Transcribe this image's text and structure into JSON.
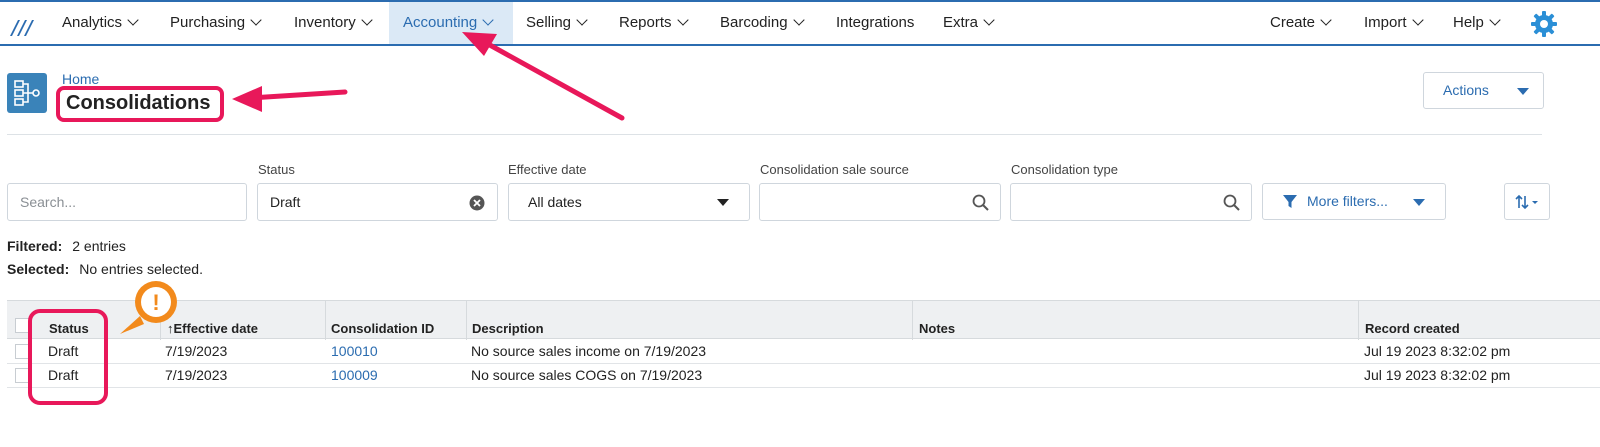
{
  "nav": {
    "items": [
      {
        "label": "Analytics"
      },
      {
        "label": "Purchasing"
      },
      {
        "label": "Inventory"
      },
      {
        "label": "Accounting"
      },
      {
        "label": "Selling"
      },
      {
        "label": "Reports"
      },
      {
        "label": "Barcoding"
      },
      {
        "label": "Integrations"
      },
      {
        "label": "Extra"
      }
    ],
    "right_items": [
      {
        "label": "Create"
      },
      {
        "label": "Import"
      },
      {
        "label": "Help"
      }
    ],
    "active": "Accounting",
    "accent_color": "#2b6cb0"
  },
  "breadcrumb": {
    "home": "Home"
  },
  "page": {
    "title": "Consolidations",
    "actions_label": "Actions"
  },
  "filters": {
    "search_placeholder": "Search...",
    "status_label": "Status",
    "status_value": "Draft",
    "effective_date_label": "Effective date",
    "effective_date_value": "All dates",
    "sale_source_label": "Consolidation sale source",
    "type_label": "Consolidation type",
    "more_filters_label": "More filters..."
  },
  "summary": {
    "filtered_label": "Filtered:",
    "filtered_value": "2 entries",
    "selected_label": "Selected:",
    "selected_value": "No entries selected."
  },
  "table": {
    "columns": [
      "Status",
      "Effective date",
      "Consolidation ID",
      "Description",
      "Notes",
      "Record created"
    ],
    "rows": [
      {
        "status": "Draft",
        "effective_date": "7/19/2023",
        "id": "100010",
        "description": "No source sales income on 7/19/2023",
        "notes": "",
        "created": "Jul 19 2023 8:32:02 pm"
      },
      {
        "status": "Draft",
        "effective_date": "7/19/2023",
        "id": "100009",
        "description": "No source sales COGS on 7/19/2023",
        "notes": "",
        "created": "Jul 19 2023 8:32:02 pm"
      }
    ]
  },
  "annotation": {
    "highlight_color": "#e8185a",
    "warning_color": "#f28a1c",
    "warning_glyph": "!"
  }
}
